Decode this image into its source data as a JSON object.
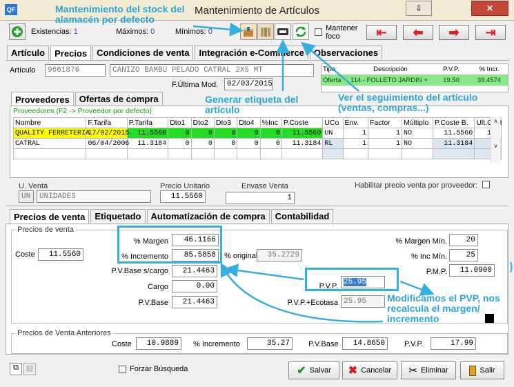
{
  "window": {
    "title": "Mantenimiento de Artículos",
    "app_badge": "QF",
    "min_glyph": "⇩",
    "close_glyph": "✕"
  },
  "toolbar": {
    "existencias_label": "Existencias:",
    "existencias_value": "1",
    "maximos_label": "Máximos:",
    "maximos_value": "0",
    "minimos_label": "Mínimos:",
    "minimos_value": "0",
    "mantener_foco": "Mantener foco"
  },
  "main_tabs": [
    "Artículo",
    "Precios",
    "Condiciones de venta",
    "Integración e-Commerce",
    "Observaciones"
  ],
  "article": {
    "label": "Artículo",
    "code": "9661876",
    "description": "CANIZO BAMBU PELADO CATRAL 2X5 MT",
    "ultima_mod_label": "F.Última Mod.",
    "ultima_mod_value": "02/03/2015"
  },
  "offer_table": {
    "headers": [
      "Tipo",
      "Descripción",
      "P.V.P.",
      "% Incr."
    ],
    "row": [
      "Oferta",
      "114.- FOLLETO JARDIN +",
      "19.50",
      "39.4574"
    ]
  },
  "sub_tabs": [
    "Proveedores",
    "Ofertas de compra"
  ],
  "prov_hint": "Proveedores (F2 -> Proveedor por defecto)",
  "prov_table": {
    "headers": [
      "Nombre",
      "F.Tarifa",
      "P.Tarifa",
      "Dto1",
      "Dto2",
      "Dto3",
      "Dto4",
      "%Inc",
      "P.Coste",
      "UCo",
      "Env.",
      "Factor",
      "Múltiplo",
      "P.Coste B.",
      "Ult.Coste"
    ],
    "rows": [
      [
        "QUALITY FERRETERIA",
        "17/02/2015",
        "11.5560",
        "0",
        "0",
        "0",
        "0",
        "0",
        "11.5560",
        "UN",
        "1",
        "1",
        "NO",
        "11.5560",
        "11."
      ],
      [
        "CATRAL",
        "06/04/2006",
        "11.3184",
        "0",
        "0",
        "0",
        "0",
        "0",
        "11.3184",
        "RL",
        "1",
        "1",
        "NO",
        "11.3184",
        "9."
      ]
    ]
  },
  "unidad": {
    "label": "U. Venta",
    "code": "UN",
    "name": "UNIDADES",
    "precio_unitario_label": "Precio Unitario",
    "precio_unitario_value": "11.5560",
    "envase_label": "Envase Venta",
    "envase_value": "1",
    "habilitar_label": "Habilitar precio venta por proveedor:"
  },
  "price_tabs": [
    "Precios de venta",
    "Etiquetado",
    "Automatización de compra",
    "Contabilidad"
  ],
  "precios_venta": {
    "group_label": "Precios de venta",
    "coste_label": "Coste",
    "coste_value": "11.5560",
    "margen_label": "% Margen",
    "margen_value": "46.1166",
    "incremento_label": "% Incremento",
    "incremento_value": "85.5858",
    "original_label": "% original",
    "original_value": "35.2729",
    "pvbase_cargo_label": "P.V.Base s/cargo",
    "pvbase_cargo_value": "21.4463",
    "cargo_label": "Cargo",
    "cargo_value": "0.00",
    "pvbase_label": "P.V.Base",
    "pvbase_value": "21.4463",
    "margen_min_label": "% Margen Mín.",
    "margen_min_value": "20",
    "inc_min_label": "% Inc Mín.",
    "inc_min_value": "25",
    "pmp_label": "P.M.P.",
    "pmp_value": "11.0900",
    "pvp_label": "P.V.P.",
    "pvp_value": "25.95",
    "pvp_ecotasa_label": "P.V.P.+Ecotasa",
    "pvp_ecotasa_value": "25.95"
  },
  "anteriores": {
    "group_label": "Precios de Venta Anteriores",
    "coste_label": "Coste",
    "coste_value": "10.9889",
    "incremento_label": "% Incremento",
    "incremento_value": "35.27",
    "pvbase_label": "P.V.Base",
    "pvbase_value": "14.8650",
    "pvp_label": "P.V.P.",
    "pvp_value": "17.99"
  },
  "bottom": {
    "forzar_label": "Forzar Búsqueda",
    "salvar_label": "Salvar",
    "cancelar_label": "Cancelar",
    "eliminar_label": "Eliminar",
    "salir_label": "Salir"
  },
  "annotations": {
    "stock": "Mantenimiento del stock del alamacén por defecto",
    "etiqueta": "Generar etiqueta del artículo",
    "seguimiento": "Ver el seguimiento del artículo (ventas, compras...)",
    "pvp": "Modificamos el PVP, nos recalcula el margen/ incremento"
  },
  "colors": {
    "annotation": "#2aa6d8",
    "grid_green": "#22dd22",
    "grid_yellow": "#ffff00",
    "nav_red": "#e02020"
  }
}
